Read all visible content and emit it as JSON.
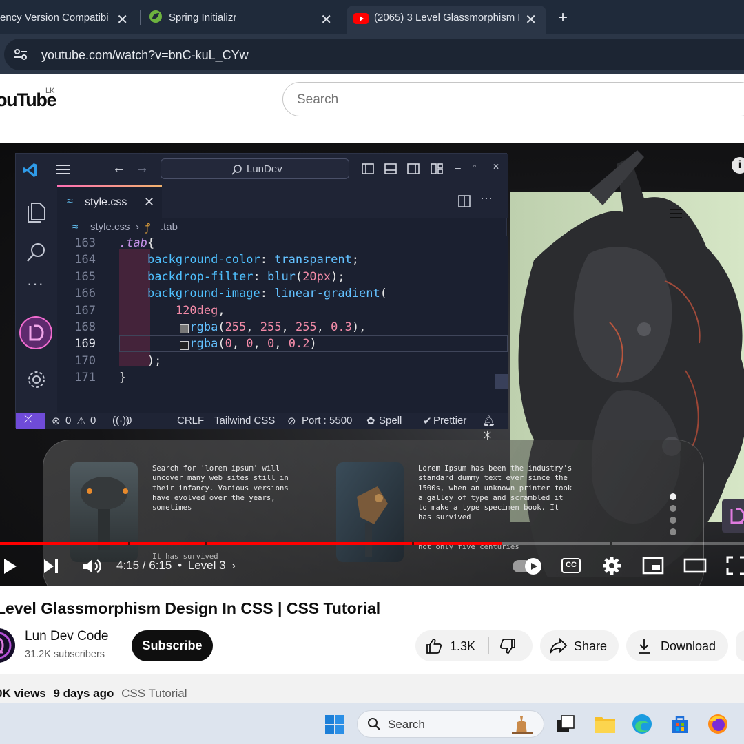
{
  "browser": {
    "tabs": [
      {
        "title": "ency Version Compatibi"
      },
      {
        "title": "Spring Initializr"
      },
      {
        "title": "(2065) 3 Level Glassmorphism D"
      }
    ],
    "new_tab_label": "+",
    "url": "youtube.com/watch?v=bnC-kuL_CYw"
  },
  "youtube": {
    "logo_text": "ouTube",
    "region": "LK",
    "search_placeholder": "Search"
  },
  "vscode": {
    "command_center": "LunDev",
    "tab_label": "style.css",
    "breadcrumb_file": "style.css",
    "breadcrumb_symbol": ".tab",
    "lines": [
      {
        "num": "163",
        "code": ".tab{"
      },
      {
        "num": "164",
        "code": "    background-color: transparent;"
      },
      {
        "num": "165",
        "code": "    backdrop-filter: blur(20px);"
      },
      {
        "num": "166",
        "code": "    background-image: linear-gradient("
      },
      {
        "num": "167",
        "code": "        120deg,"
      },
      {
        "num": "168",
        "code": "        rgba(255, 255, 255, 0.3),"
      },
      {
        "num": "169",
        "code": "        rgba(0, 0, 0, 0.2)"
      },
      {
        "num": "170",
        "code": "    );"
      },
      {
        "num": "171",
        "code": "}"
      }
    ],
    "status": {
      "errors": "0",
      "warnings": "0",
      "ports": "0",
      "eol": "CRLF",
      "language": "Tailwind CSS",
      "port": "Port : 5500",
      "spell": "Spell",
      "prettier": "Prettier"
    }
  },
  "video_content": {
    "card1_text": "Search for 'lorem ipsum' will\nuncover many web sites still in\ntheir infancy. Various versions\nhave evolved over the years,\nsometimes",
    "card1_text2": "It has survived",
    "card2_text": "Lorem Ipsum has been the industry's\nstandard dummy text ever since the\n1500s, when an unknown printer took\na galley of type and scrambled it\nto make a type specimen book. It\nhas survived",
    "card2_text2": "not only five centuries"
  },
  "player": {
    "progress": 0.675,
    "time": "4:15 / 6:15",
    "chapter": "Level 3",
    "colors": {
      "progress": "#ff0000"
    }
  },
  "video_meta": {
    "title": "Level Glassmorphism Design In CSS | CSS Tutorial",
    "channel": "Lun Dev Code",
    "subscribers": "31.2K subscribers",
    "subscribe_label": "Subscribe",
    "likes": "1.3K",
    "share_label": "Share",
    "download_label": "Download",
    "views": "0K views",
    "date": "9 days ago",
    "tag": "CSS Tutorial"
  },
  "taskbar": {
    "search_placeholder": "Search"
  }
}
